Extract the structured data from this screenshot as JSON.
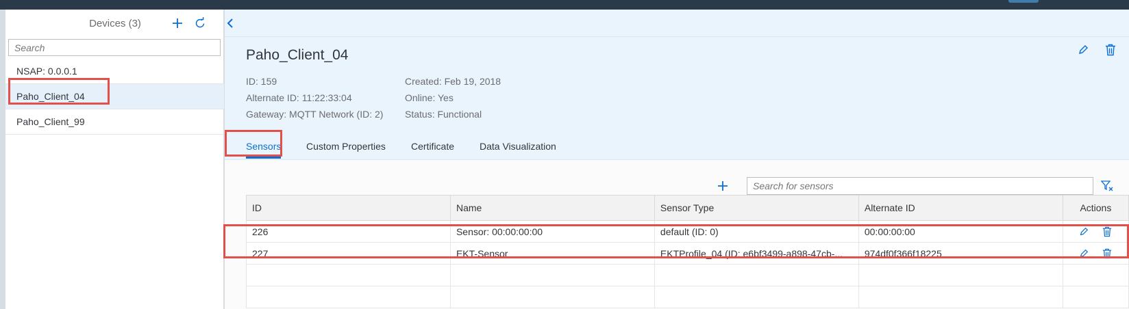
{
  "master": {
    "title": "Devices (3)",
    "search_placeholder": "Search",
    "items": [
      {
        "label": "NSAP: 0.0.0.1"
      },
      {
        "label": "Paho_Client_04"
      },
      {
        "label": "Paho_Client_99"
      }
    ]
  },
  "detail": {
    "title": "Paho_Client_04",
    "attributes": {
      "id": "ID: 159",
      "alternate_id": "Alternate ID: 11:22:33:04",
      "gateway": "Gateway: MQTT Network (ID: 2)",
      "created": "Created: Feb 19, 2018",
      "online": "Online: Yes",
      "status": "Status: Functional"
    },
    "tabs": [
      {
        "label": "Sensors"
      },
      {
        "label": "Custom Properties"
      },
      {
        "label": "Certificate"
      },
      {
        "label": "Data Visualization"
      }
    ]
  },
  "sensors": {
    "search_placeholder": "Search for sensors",
    "columns": [
      "ID",
      "Name",
      "Sensor Type",
      "Alternate ID",
      "Actions"
    ],
    "rows": [
      {
        "id": "226",
        "name": "Sensor: 00:00:00:00",
        "type": "default (ID: 0)",
        "alt_id": "00:00:00:00"
      },
      {
        "id": "227",
        "name": "EKT-Sensor",
        "type": "EKTProfile_04 (ID: e6bf3499-a898-47cb-...",
        "alt_id": "974df0f366f18225"
      }
    ]
  },
  "colors": {
    "accent": "#0a6ed1",
    "highlight": "#e3504a",
    "shell": "#2b3a49"
  }
}
